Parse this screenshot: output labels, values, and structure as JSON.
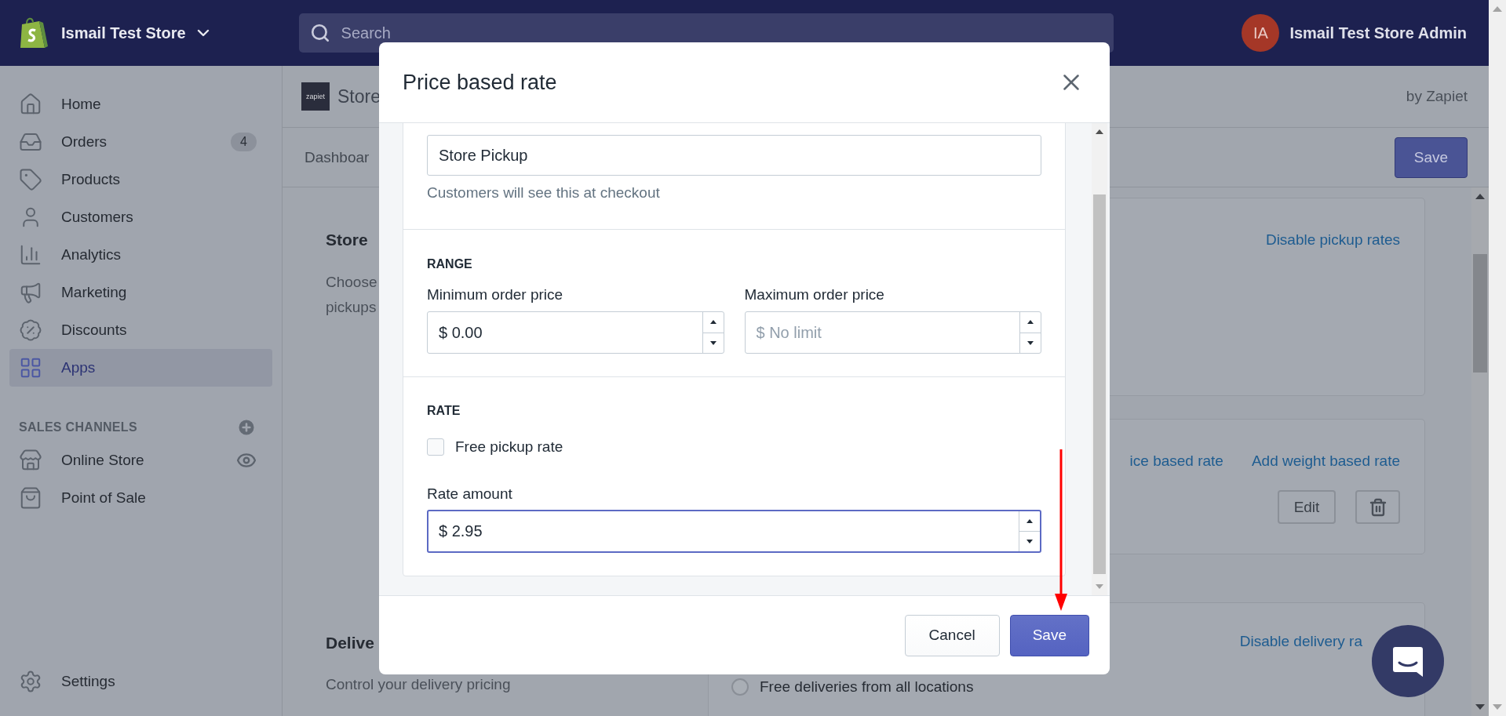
{
  "topbar": {
    "store_name": "Ismail Test Store",
    "search": {
      "placeholder": "Search"
    },
    "user": {
      "initials": "IA",
      "name": "Ismail Test Store Admin"
    }
  },
  "sidebar": {
    "items": [
      {
        "kind": "home",
        "label": "Home",
        "selected": false
      },
      {
        "kind": "orders",
        "label": "Orders",
        "badge": "4",
        "selected": false
      },
      {
        "kind": "products",
        "label": "Products",
        "selected": false
      },
      {
        "kind": "customers",
        "label": "Customers",
        "selected": false
      },
      {
        "kind": "analytics",
        "label": "Analytics",
        "selected": false
      },
      {
        "kind": "marketing",
        "label": "Marketing",
        "selected": false
      },
      {
        "kind": "discounts",
        "label": "Discounts",
        "selected": false
      },
      {
        "kind": "apps",
        "label": "Apps",
        "selected": true
      }
    ],
    "sales_channels": {
      "heading": "SALES CHANNELS",
      "items": [
        {
          "kind": "online_store",
          "label": "Online Store"
        },
        {
          "kind": "pos",
          "label": "Point of Sale"
        }
      ]
    },
    "settings": {
      "label": "Settings"
    }
  },
  "app_header": {
    "logo_text": "zapiet",
    "title": "Store",
    "vendor": "by Zapiet"
  },
  "tab_bar": {
    "tabs": [
      {
        "label": "Dashboar"
      }
    ],
    "save_button": "Save"
  },
  "sections": [
    {
      "heading": "Store",
      "description_lines": [
        "Choose",
        "pickups"
      ],
      "cards": [
        {
          "links": [
            "Disable pickup rates"
          ]
        },
        {
          "links": [
            "ice based rate",
            "Add weight based rate"
          ],
          "edit_button": "Edit"
        }
      ]
    },
    {
      "heading": "Delive",
      "description_lines": [
        "Control your delivery pricing"
      ],
      "cards": [
        {
          "links": [
            "Disable delivery ra"
          ],
          "options": [
            {
              "label": "Free deliveries from all locations",
              "selected": false
            }
          ]
        }
      ]
    }
  ],
  "modal": {
    "title": "Price based rate",
    "name_field": {
      "value": "Store Pickup",
      "help": "Customers will see this at checkout"
    },
    "range": {
      "heading": "RANGE",
      "fields": [
        {
          "label": "Minimum order price",
          "value": "$ 0.00"
        },
        {
          "label": "Maximum order price",
          "placeholder": "$ No limit"
        }
      ]
    },
    "rate": {
      "heading": "RATE",
      "free_pickup": {
        "label": "Free pickup rate",
        "checked": false
      },
      "amount": {
        "label": "Rate amount",
        "value": "$ 2.95",
        "focused": true
      }
    },
    "buttons": [
      {
        "kind": "secondary",
        "label": "Cancel"
      },
      {
        "kind": "primary",
        "label": "Save"
      }
    ]
  }
}
